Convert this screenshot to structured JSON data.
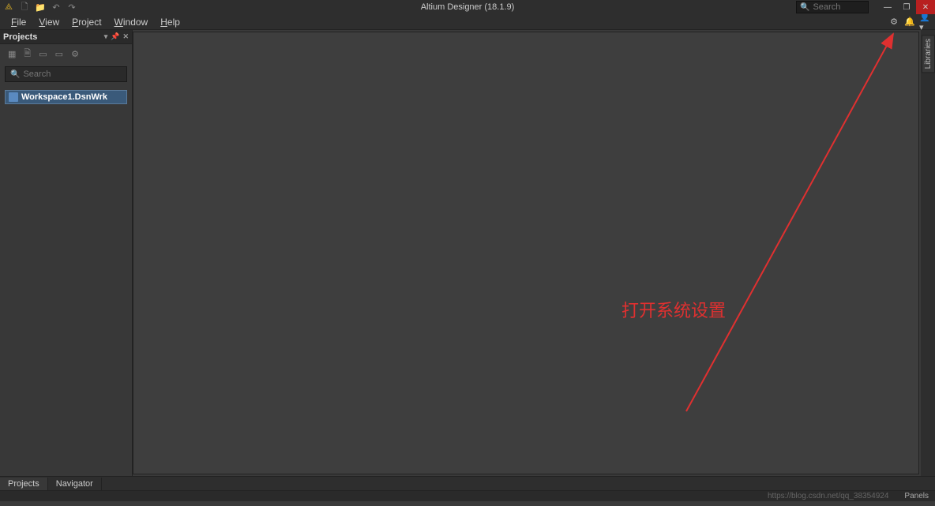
{
  "titlebar": {
    "title": "Altium Designer (18.1.9)",
    "search_placeholder": "Search"
  },
  "menubar": {
    "items": [
      {
        "prefix": "",
        "u": "F",
        "suffix": "ile"
      },
      {
        "prefix": "",
        "u": "V",
        "suffix": "iew"
      },
      {
        "prefix": "",
        "u": "P",
        "suffix": "roject"
      },
      {
        "prefix": "",
        "u": "W",
        "suffix": "indow"
      },
      {
        "prefix": "",
        "u": "H",
        "suffix": "elp"
      }
    ]
  },
  "panel": {
    "title": "Projects",
    "search_placeholder": "Search",
    "tree_item": "Workspace1.DsnWrk"
  },
  "right_sidebar": {
    "tab": "Libraries"
  },
  "bottom_tabs": {
    "items": [
      "Projects",
      "Navigator"
    ]
  },
  "statusbar": {
    "watermark": "https://blog.csdn.net/qq_38354924",
    "panels": "Panels"
  },
  "annotation": {
    "text": "打开系统设置"
  }
}
